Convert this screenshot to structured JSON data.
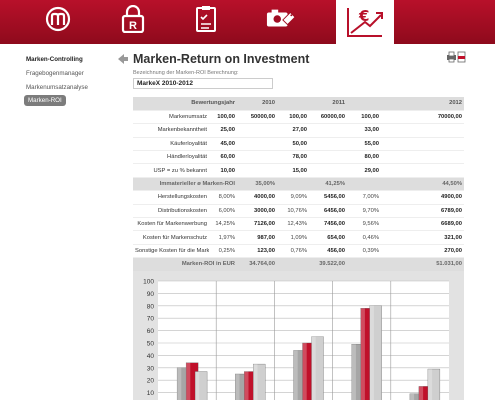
{
  "nav": {
    "items": [
      {
        "icon": "brand-logo-icon",
        "active": false
      },
      {
        "icon": "trademark-lock-icon",
        "active": false
      },
      {
        "icon": "checklist-icon",
        "active": false
      },
      {
        "icon": "camera-tag-icon",
        "active": false
      },
      {
        "icon": "euro-growth-icon",
        "active": true
      }
    ]
  },
  "sidebar": {
    "items": [
      {
        "label": "Marken-Controlling",
        "style": "bold"
      },
      {
        "label": "Fragebogenmanager",
        "style": "normal"
      },
      {
        "label": "Markenumsatzanalyse",
        "style": "normal"
      },
      {
        "label": "Marken-ROI",
        "style": "selected"
      }
    ]
  },
  "page": {
    "title": "Marken-Return on Investment"
  },
  "form": {
    "label": "Bezeichnung der Marken-ROI Berechnung:",
    "value": "MarkeX 2010-2012"
  },
  "table": {
    "header": {
      "label": "Bewertungsjahr",
      "years": [
        "2010",
        "2011",
        "2012"
      ]
    },
    "section1": [
      {
        "label": "Markenumsatz",
        "v2010a": "100,00",
        "v2010b": "50000,00",
        "v2011a": "100,00",
        "v2011b": "60000,00",
        "v2012a": "100,00",
        "v2012b": "70000,00"
      },
      {
        "label": "Markenbekanntheit",
        "v2010a": "25,00",
        "v2010b": "",
        "v2011a": "27,00",
        "v2011b": "",
        "v2012a": "33,00",
        "v2012b": ""
      },
      {
        "label": "Käuferloyalität",
        "v2010a": "45,00",
        "v2010b": "",
        "v2011a": "50,00",
        "v2011b": "",
        "v2012a": "55,00",
        "v2012b": ""
      },
      {
        "label": "Händlerloyalität",
        "v2010a": "60,00",
        "v2010b": "",
        "v2011a": "78,00",
        "v2011b": "",
        "v2012a": "80,00",
        "v2012b": ""
      },
      {
        "label": "USP = zu % bekannt",
        "v2010a": "10,00",
        "v2010b": "",
        "v2011a": "15,00",
        "v2011b": "",
        "v2012a": "29,00",
        "v2012b": ""
      }
    ],
    "group1": {
      "label": "Immaterieller ø Marken-ROI",
      "p2010": "35,00%",
      "p2011": "41,25%",
      "p2012": "44,50%"
    },
    "section2": [
      {
        "label": "Herstellungskosten",
        "p2010": "8,00%",
        "v2010": "4000,00",
        "p2011": "9,09%",
        "v2011": "5456,00",
        "p2012": "7,00%",
        "v2012": "4900,00"
      },
      {
        "label": "Distributionskosten",
        "p2010": "6,00%",
        "v2010": "3000,00",
        "p2011": "10,76%",
        "v2011": "6456,00",
        "p2012": "9,70%",
        "v2012": "6789,00"
      },
      {
        "label": "Kosten für Markenwerbung",
        "p2010": "14,25%",
        "v2010": "7126,00",
        "p2011": "12,43%",
        "v2011": "7456,00",
        "p2012": "9,56%",
        "v2012": "6689,00"
      },
      {
        "label": "Kosten für Markenschutz",
        "p2010": "1,97%",
        "v2010": "987,00",
        "p2011": "1,09%",
        "v2011": "654,00",
        "p2012": "0,46%",
        "v2012": "321,00"
      },
      {
        "label": "Sonstige Kosten für die Marke",
        "p2010": "0,25%",
        "v2010": "123,00",
        "p2011": "0,76%",
        "v2011": "456,00",
        "p2012": "0,39%",
        "v2012": "270,00"
      }
    ],
    "group2": {
      "label": "Marken-ROI in EUR",
      "v2010": "34.764,00",
      "v2011": "39.522,00",
      "v2012": "51.031,00"
    }
  },
  "chart_data": {
    "type": "bar",
    "ylim": [
      0,
      100
    ],
    "yticks": [
      "100",
      "90",
      "80",
      "70",
      "60",
      "50",
      "40",
      "30",
      "20",
      "10",
      "0"
    ],
    "grid": true,
    "colors": [
      "#a6a6a6",
      "#c0102a",
      "#cfcfcf"
    ],
    "series": [
      {
        "values": [
          30,
          25,
          44,
          49,
          9
        ]
      },
      {
        "values": [
          34,
          27,
          50,
          78,
          15
        ]
      },
      {
        "values": [
          27,
          33,
          55,
          80,
          29
        ]
      }
    ]
  }
}
